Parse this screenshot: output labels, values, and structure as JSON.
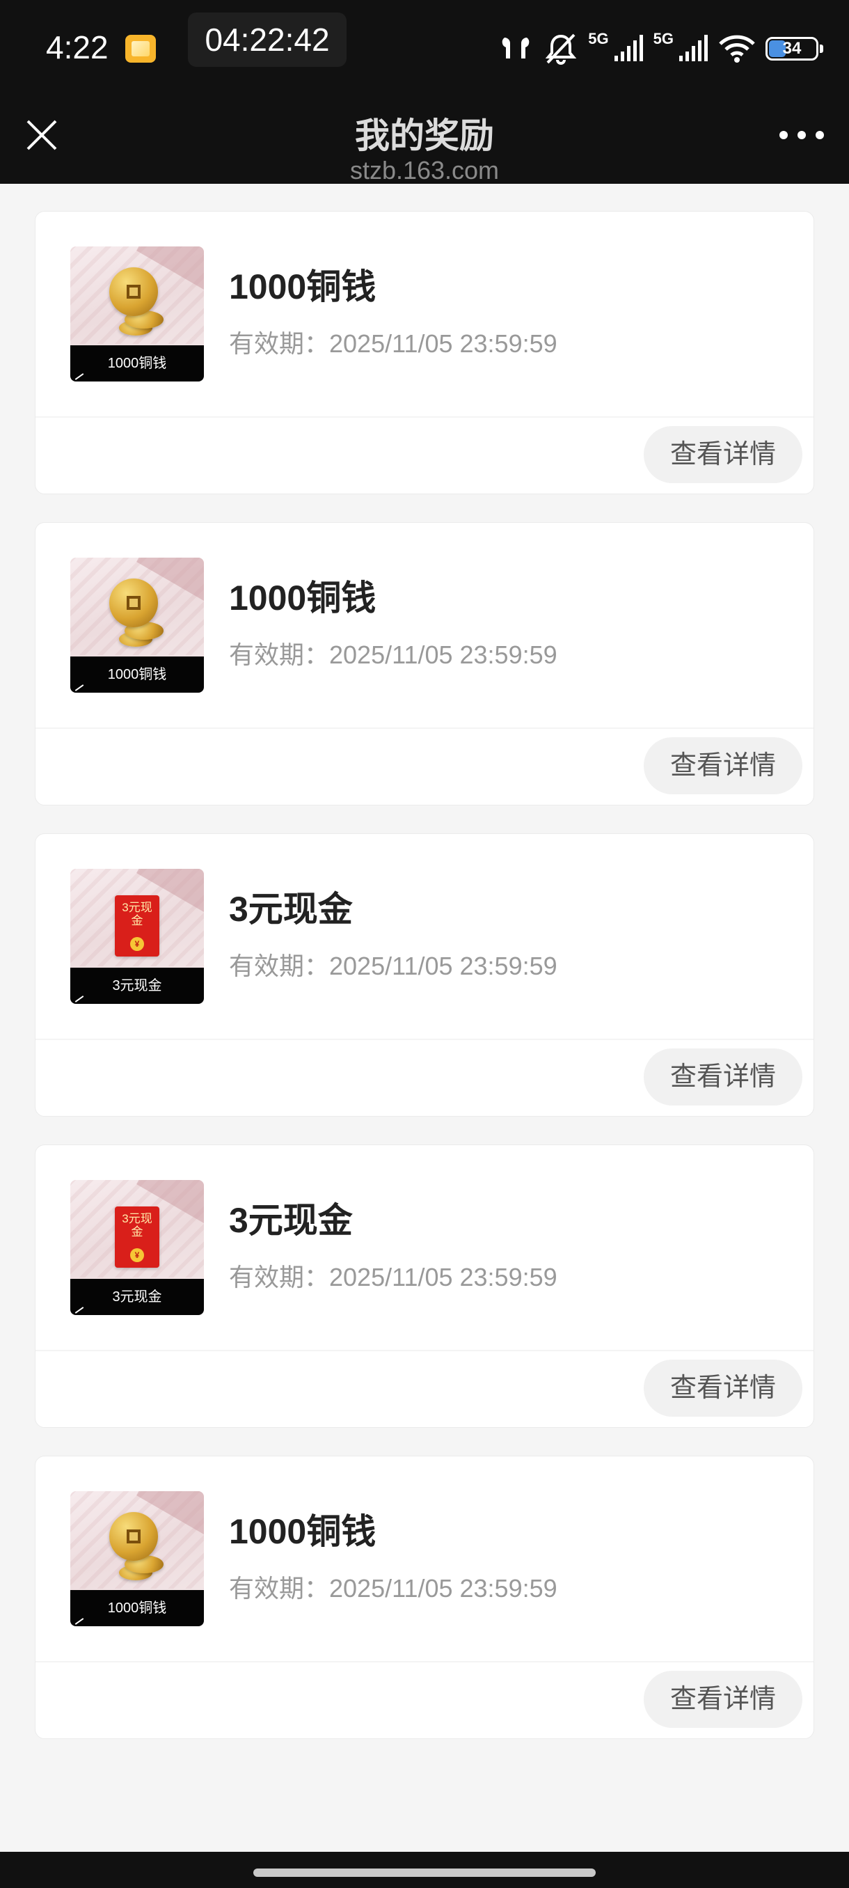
{
  "status_bar": {
    "time": "4:22",
    "clock_overlay": "04:22:42",
    "network_1": "5G",
    "network_2": "5G",
    "battery": "34"
  },
  "header": {
    "title": "我的奖励",
    "subtitle": "stzb.163.com"
  },
  "icons": {
    "close": "close-icon",
    "more": "more-icon"
  },
  "rewards": [
    {
      "thumb_label": "1000铜钱",
      "title": "1000铜钱",
      "expiry": "有效期：2025/11/05 23:59:59",
      "button": "查看详情"
    },
    {
      "thumb_label": "1000铜钱",
      "title": "1000铜钱",
      "expiry": "有效期：2025/11/05 23:59:59",
      "button": "查看详情"
    },
    {
      "thumb_label": "3元现金",
      "thumb_text": "3元现金",
      "title": "3元现金",
      "expiry": "有效期：2025/11/05 23:59:59",
      "button": "查看详情"
    },
    {
      "thumb_label": "3元现金",
      "thumb_text": "3元现金",
      "title": "3元现金",
      "expiry": "有效期：2025/11/05 23:59:59",
      "button": "查看详情"
    },
    {
      "thumb_label": "1000铜钱",
      "title": "1000铜钱",
      "expiry": "有效期：2025/11/05 23:59:59",
      "button": "查看详情"
    }
  ],
  "colors": {
    "header_bg": "#111111",
    "page_bg": "#f5f5f5",
    "red_packet": "#d91f1a",
    "coin_gold": "#d9a431"
  }
}
